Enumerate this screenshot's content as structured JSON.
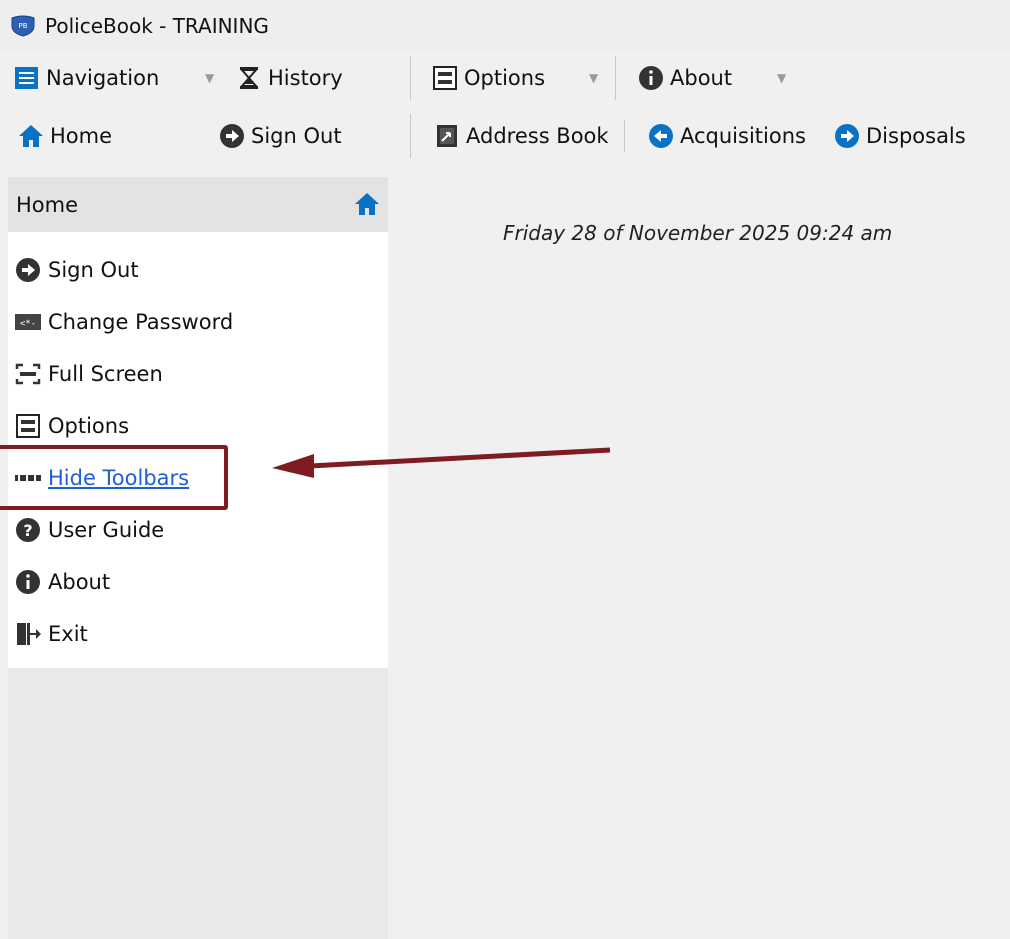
{
  "window": {
    "title": "PoliceBook - TRAINING",
    "app_icon_text": "PB"
  },
  "toolbar": {
    "row1": [
      {
        "label": "Navigation",
        "icon": "list-icon",
        "has_dropdown": true
      },
      {
        "label": "History",
        "icon": "hourglass-icon",
        "has_dropdown": false
      },
      {
        "label": "Options",
        "icon": "options-icon",
        "has_dropdown": true
      },
      {
        "label": "About",
        "icon": "info-icon",
        "has_dropdown": true
      }
    ],
    "row2": [
      {
        "label": "Home",
        "icon": "home-icon"
      },
      {
        "label": "Sign Out",
        "icon": "sign-out-icon"
      },
      {
        "label": "Address Book",
        "icon": "address-book-icon"
      },
      {
        "label": "Acquisitions",
        "icon": "arrow-left-circle-icon"
      },
      {
        "label": "Disposals",
        "icon": "arrow-right-circle-icon"
      }
    ]
  },
  "sidebar": {
    "title": "Home",
    "items": [
      {
        "label": "Sign Out",
        "icon": "sign-out-icon"
      },
      {
        "label": "Change Password",
        "icon": "password-icon"
      },
      {
        "label": "Full Screen",
        "icon": "full-screen-icon"
      },
      {
        "label": "Options",
        "icon": "options-icon"
      },
      {
        "label": "Hide Toolbars",
        "icon": "dots-icon",
        "hovered": true
      },
      {
        "label": "User Guide",
        "icon": "help-icon"
      },
      {
        "label": "About",
        "icon": "info-icon"
      },
      {
        "label": "Exit",
        "icon": "exit-icon"
      }
    ]
  },
  "main": {
    "date_text": "Friday 28 of November 2025 09:24 am"
  },
  "colors": {
    "accent_blue": "#0a72c4",
    "link_blue": "#1f5fd4",
    "annotation_red": "#7d1d22"
  }
}
